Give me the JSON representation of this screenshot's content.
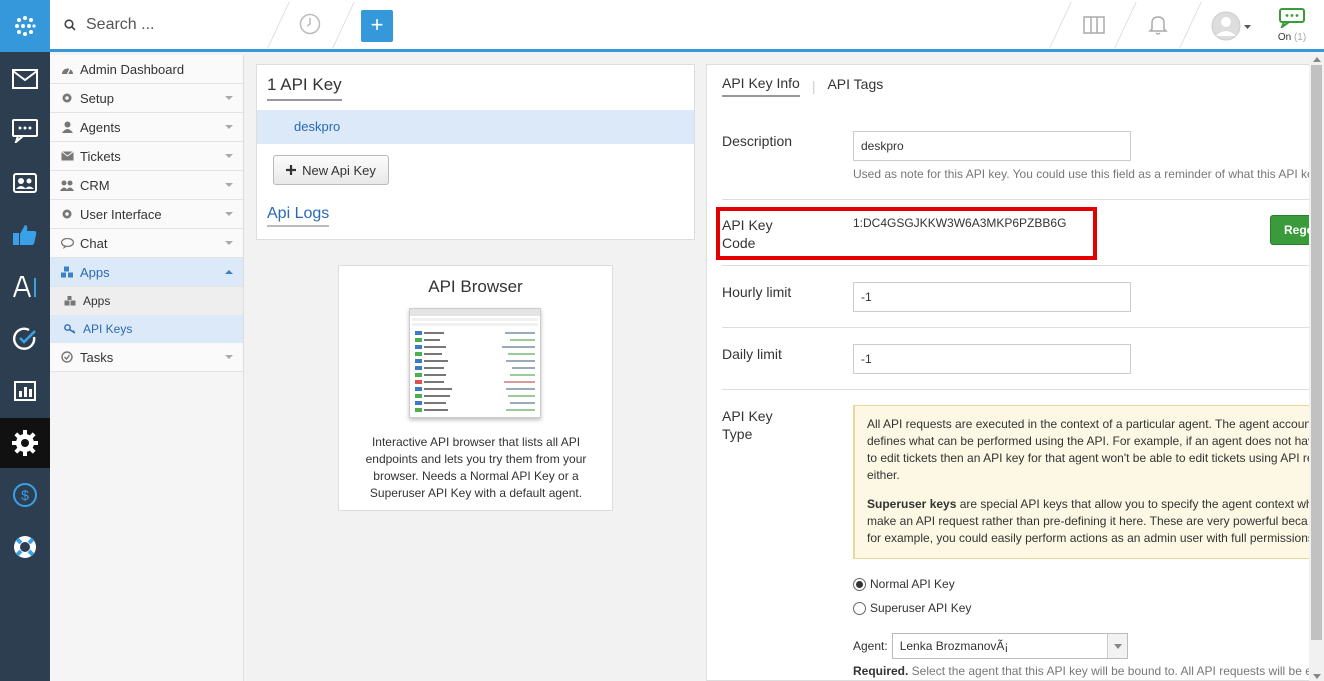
{
  "topbar": {
    "search_placeholder": "Search ...",
    "plus_label": "+",
    "chat_status": "On",
    "chat_count": "(1)",
    "accent_color": "#3498db"
  },
  "iconbar": {
    "icons": [
      "apps-grid-icon",
      "mail-icon",
      "chat-icon",
      "contacts-icon",
      "feedback-thumb-icon",
      "publish-icon",
      "tasks-check-icon",
      "reports-icon",
      "settings-gear-icon",
      "billing-dollar-icon",
      "help-lifebuoy-icon"
    ],
    "active": "settings-gear-icon"
  },
  "sidebar": {
    "items": [
      {
        "label": "Admin Dashboard",
        "icon": "dashboard-icon"
      },
      {
        "label": "Setup",
        "icon": "gear-icon"
      },
      {
        "label": "Agents",
        "icon": "user-icon"
      },
      {
        "label": "Tickets",
        "icon": "tickets-icon"
      },
      {
        "label": "CRM",
        "icon": "crm-users-icon"
      },
      {
        "label": "User Interface",
        "icon": "gear-icon"
      },
      {
        "label": "Chat",
        "icon": "chat-bubble-icon"
      },
      {
        "label": "Apps",
        "icon": "apps-cubes-icon"
      },
      {
        "label": "Tasks",
        "icon": "check-circle-icon"
      }
    ],
    "apps_sub": [
      {
        "label": "Apps",
        "icon": "puzzle-icon"
      },
      {
        "label": "API Keys",
        "icon": "key-icon"
      }
    ]
  },
  "keys": {
    "heading": "1 API Key",
    "items": [
      "deskpro"
    ],
    "new_button": "New Api Key",
    "logs_link": "Api Logs"
  },
  "browser": {
    "title": "API Browser",
    "description": "Interactive API browser that lists all API endpoints and lets you try them from your browser. Needs a Normal API Key or a Superuser API Key with a default agent."
  },
  "detail": {
    "tabs": [
      "API Key Info",
      "API Tags"
    ],
    "description_label": "Description",
    "description_value": "deskpro",
    "description_help": "Used as note for this API key. You could use this field as a reminder of what this API ke",
    "code_label_1": "API Key",
    "code_label_2": "Code",
    "code_value": "1:DC4GSGJKKW3W6A3MKP6PZBB6G",
    "regenerate_label": "Regen",
    "hourly_label": "Hourly limit",
    "hourly_value": "-1",
    "daily_label": "Daily limit",
    "daily_value": "-1",
    "type_label_1": "API Key",
    "type_label_2": "Type",
    "note_p1_l1": "All API requests are executed in the context of a particular agent. The agent accoun",
    "note_p1_l2": "defines what can be performed using the API. For example, if an agent does not hav",
    "note_p1_l3": "to edit tickets then an API key for that agent won't be able to edit tickets using API re",
    "note_p1_l4": "either.",
    "note_p2_bold": "Superuser keys",
    "note_p2_l1": " are special API keys that allow you to specify the agent context wh",
    "note_p2_l2": "make an API request rather than pre-defining it here. These are very powerful beca",
    "note_p2_l3": "for example, you could easily perform actions as an admin user with full permissions",
    "radio_normal": "Normal API Key",
    "radio_super": "Superuser API Key",
    "selected_type": "normal",
    "agent_label": "Agent:",
    "agent_value": "Lenka BrozmanovÃ¡",
    "required_bold": "Required.",
    "required_text": " Select the agent that this API key will be bound to. All API requests will be e"
  }
}
